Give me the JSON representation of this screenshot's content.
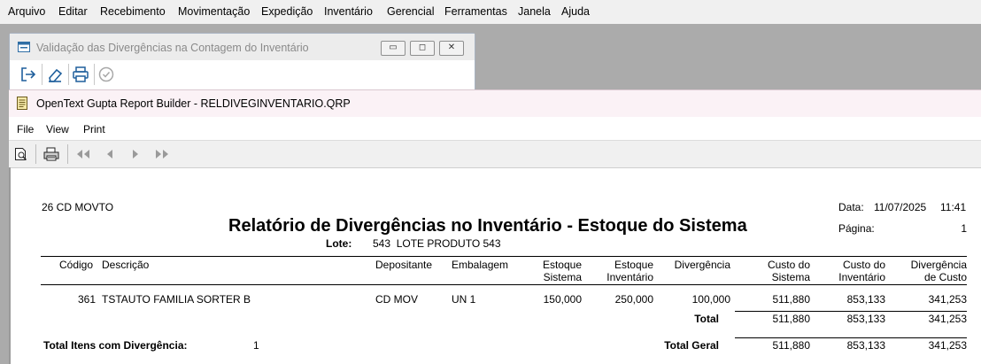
{
  "main_menu": [
    "Arquivo",
    "Editar",
    "Recebimento",
    "Movimentação",
    "Expedição",
    "Inventário",
    "Gerencial",
    "Ferramentas",
    "Janela",
    "Ajuda"
  ],
  "validation_window": {
    "title": "Validação das Divergências na Contagem do Inventário",
    "controls": {
      "minimize": "▭",
      "maximize": "◻",
      "close": "✕"
    }
  },
  "report_window": {
    "title": "OpenText Gupta Report Builder - RELDIVEGINVENTARIO.QRP",
    "menu": [
      "File",
      "View",
      "Print"
    ]
  },
  "report": {
    "company": "26 CD MOVTO",
    "title": "Relatório de Divergências no Inventário - Estoque do Sistema",
    "data_label": "Data:",
    "date": "11/07/2025",
    "time": "11:41",
    "pagina_label": "Página:",
    "page": "1",
    "lote_label": "Lote:",
    "lote_value": "543  LOTE PRODUTO 543",
    "columns": {
      "codigo": "Código",
      "descricao": "Descrição",
      "depositante": "Depositante",
      "embalagem": "Embalagem",
      "estoque_sistema_1": "Estoque",
      "estoque_sistema_2": "Sistema",
      "estoque_inventario_1": "Estoque",
      "estoque_inventario_2": "Inventário",
      "divergencia": "Divergência",
      "custo_sistema_1": "Custo do",
      "custo_sistema_2": "Sistema",
      "custo_inventario_1": "Custo do",
      "custo_inventario_2": "Inventário",
      "divergencia_custo_1": "Divergência",
      "divergencia_custo_2": "de Custo"
    },
    "row": {
      "codigo": "361",
      "descricao": "TSTAUTO FAMILIA SORTER B",
      "depositante": "CD MOV",
      "embalagem": "UN 1",
      "estoque_sistema": "150,000",
      "estoque_inventario": "250,000",
      "divergencia": "100,000",
      "custo_sistema": "511,880",
      "custo_inventario": "853,133",
      "divergencia_custo": "341,253"
    },
    "total": {
      "label": "Total",
      "custo_sistema": "511,880",
      "custo_inventario": "853,133",
      "divergencia_custo": "341,253"
    },
    "footer": {
      "itens_label": "Total Itens com Divergência:",
      "itens_value": "1",
      "geral_label": "Total Geral",
      "custo_sistema": "511,880",
      "custo_inventario": "853,133",
      "divergencia_custo": "341,253"
    }
  }
}
